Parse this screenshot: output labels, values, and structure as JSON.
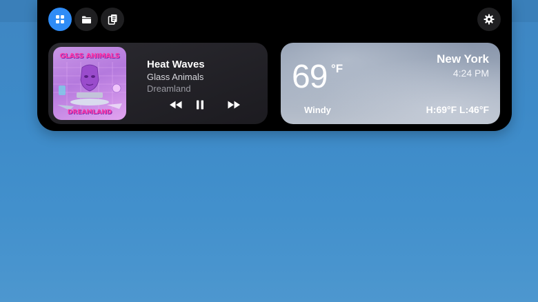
{
  "panel": {
    "tabs": [
      {
        "name": "widgets",
        "icon": "grid-icon",
        "active": true
      },
      {
        "name": "files",
        "icon": "folder-icon",
        "active": false
      },
      {
        "name": "clipboard",
        "icon": "clipboard-icon",
        "active": false
      }
    ],
    "settings_icon": "gear-icon"
  },
  "music": {
    "title": "Heat Waves",
    "artist": "Glass Animals",
    "album": "Dreamland",
    "album_art": {
      "top_text": "GLASS ANIMALS",
      "bottom_text": "DREAMLAND"
    },
    "controls": [
      "rewind-icon",
      "pause-icon",
      "fast-forward-icon"
    ]
  },
  "weather": {
    "temperature": "69",
    "unit": "°F",
    "city": "New York",
    "time": "4:24 PM",
    "condition": "Windy",
    "high_low": "H:69°F  L:46°F"
  },
  "colors": {
    "accent": "#2f8cf6",
    "panel": "#000000",
    "desktop": "#3d8ac8"
  }
}
